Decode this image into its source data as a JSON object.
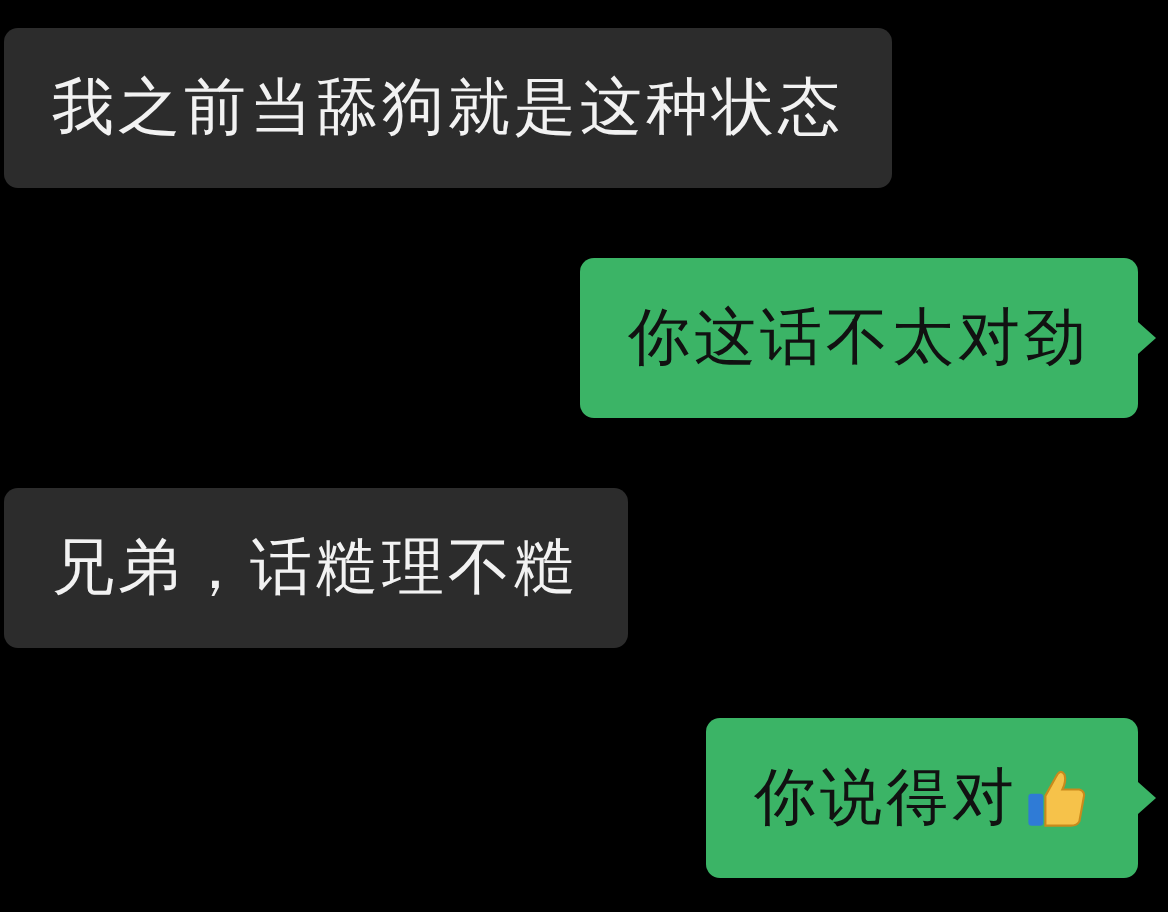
{
  "messages": [
    {
      "kind": "received",
      "text": "我之前当舔狗就是这种状态"
    },
    {
      "kind": "sent",
      "text": "你这话不太对劲"
    },
    {
      "kind": "received",
      "text": "兄弟，话糙理不糙"
    },
    {
      "kind": "sent",
      "text": "你说得对",
      "thumbs_up": true
    }
  ]
}
